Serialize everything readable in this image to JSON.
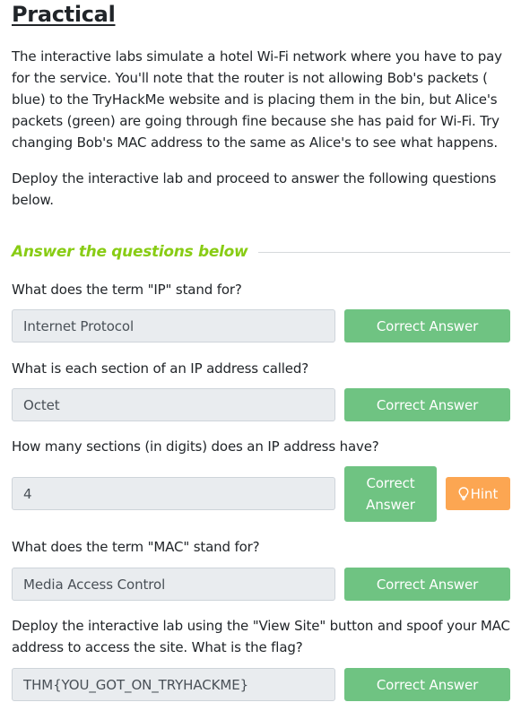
{
  "heading": "Practical",
  "intro": {
    "paragraph1": "The interactive labs simulate a hotel Wi-Fi network where you have to pay for the service. You'll note that the router is not allowing Bob's packets ( blue) to the TryHackMe website and is placing them in the bin, but Alice's packets (green) are going through fine because she has paid for Wi-Fi. Try changing Bob's MAC address to the same as Alice's to see what happens.",
    "paragraph2": "Deploy the interactive lab and proceed to answer the following questions below."
  },
  "questions_header": "Answer the questions below",
  "questions": [
    {
      "text": "What does the term \"IP\" stand for?",
      "answer": "Internet Protocol",
      "button": "Correct Answer"
    },
    {
      "text": "What is each section of an IP address called?",
      "answer": "Octet",
      "button": "Correct Answer"
    },
    {
      "text": "How many sections (in digits) does an IP address have?",
      "answer": "4",
      "button": "Correct Answer",
      "hint": "Hint"
    },
    {
      "text": "What does the term \"MAC\" stand for?",
      "answer": "Media Access Control",
      "button": "Correct Answer"
    },
    {
      "text": "Deploy the interactive lab using the \"View Site\" button and spoof your MAC address to access the site.  What is the flag?",
      "answer": "THM{YOU_GOT_ON_TRYHACKME}",
      "button": "Correct Answer"
    }
  ],
  "icons": {
    "hint": "lightbulb-icon"
  },
  "colors": {
    "accent_green": "#88cc14",
    "correct_button": "#6fc382",
    "hint_button": "#fca652",
    "answer_field_bg": "#e9ecef"
  }
}
